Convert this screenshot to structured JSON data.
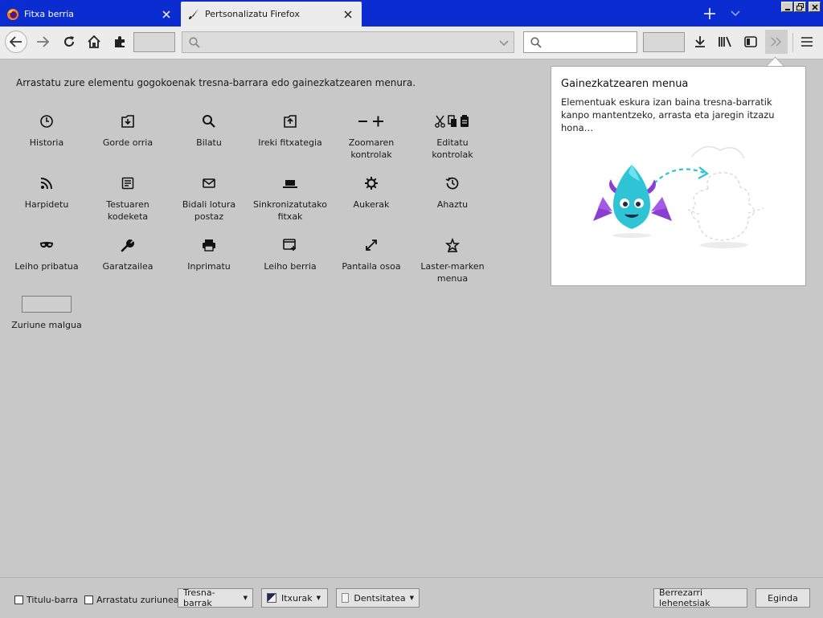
{
  "tabs": [
    {
      "label": "Fitxa berria",
      "icon": "firefox-logo-icon",
      "active": false
    },
    {
      "label": "Pertsonalizatu Firefox",
      "icon": "paintbrush-icon",
      "active": true
    }
  ],
  "colors": {
    "tabbar": "#0a2cd0",
    "toolbar": "#ececec",
    "background": "#c8c8c8",
    "accent_teal": "#2ec4d6",
    "accent_purple": "#8a3fd1"
  },
  "palette": {
    "instructions": "Arrastatu zure elementu gogokoenak tresna-barrara edo gainezkatzearen menura.",
    "items": [
      {
        "label": "Historia",
        "icon": "clock-icon"
      },
      {
        "label": "Gorde orria",
        "icon": "save-page-icon"
      },
      {
        "label": "Bilatu",
        "icon": "search-icon"
      },
      {
        "label": "Ireki fitxategia",
        "icon": "open-file-icon"
      },
      {
        "label": "Zoomaren\nkontrolak",
        "icon": "zoom-controls-icon"
      },
      {
        "label": "Editatu\nkontrolak",
        "icon": "edit-controls-icon"
      },
      {
        "label": "Harpidetu",
        "icon": "feed-icon"
      },
      {
        "label": "Testuaren\nkodeketa",
        "icon": "text-encoding-icon"
      },
      {
        "label": "Bidali lotura\npostaz",
        "icon": "email-link-icon"
      },
      {
        "label": "Sinkronizatutako\nfitxak",
        "icon": "synced-tabs-icon"
      },
      {
        "label": "Aukerak",
        "icon": "gear-icon"
      },
      {
        "label": "Ahaztu",
        "icon": "forget-icon"
      },
      {
        "label": "Leiho pribatua",
        "icon": "private-window-icon"
      },
      {
        "label": "Garatzailea",
        "icon": "wrench-icon"
      },
      {
        "label": "Inprimatu",
        "icon": "print-icon"
      },
      {
        "label": "Leiho berria",
        "icon": "new-window-icon"
      },
      {
        "label": "Pantaila osoa",
        "icon": "fullscreen-icon"
      },
      {
        "label": "Laster-marken\nmenua",
        "icon": "bookmarks-menu-icon"
      },
      {
        "label": "Zuriune malgua",
        "icon": "flexible-space"
      }
    ]
  },
  "overflow_panel": {
    "title": "Gainezkatzearen menua",
    "description": "Elementuak eskura izan baina tresna-barratik kanpo mantentzeko, arrasta eta jaregin itzazu hona…"
  },
  "footer": {
    "title_bar_label": "Titulu-barra",
    "title_bar_checked": false,
    "drag_space_label": "Arrastatu zuriunea",
    "drag_space_checked": false,
    "toolbars_label": "Tresna-barrak",
    "themes_label": "Itxurak",
    "density_label": "Dentsitatea",
    "restore_label": "Berrezarri lehenetsiak",
    "done_label": "Eginda"
  }
}
